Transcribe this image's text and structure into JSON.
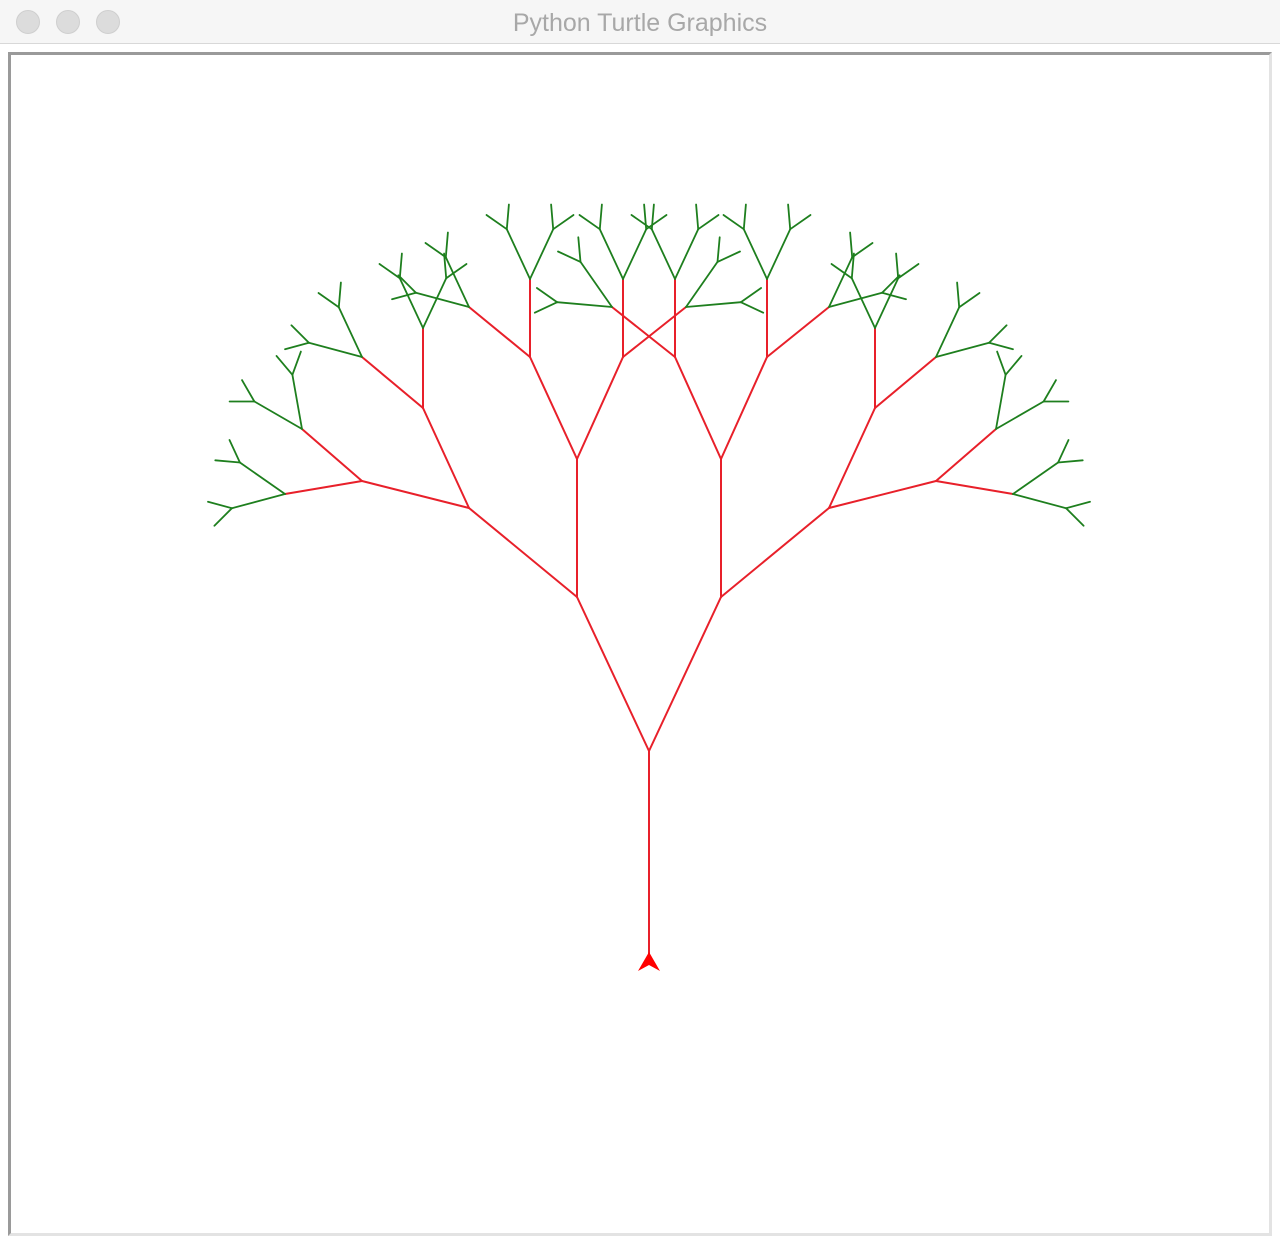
{
  "window": {
    "title": "Python Turtle Graphics"
  },
  "title_buttons": [
    {
      "name": "close-button",
      "color": "#dcdcdc"
    },
    {
      "name": "minimize-button",
      "color": "#dcdcdc"
    },
    {
      "name": "zoom-button",
      "color": "#dcdcdc"
    }
  ],
  "drawing": {
    "trunk_color": "#e8202a",
    "leaf_color": "#1e7f1e",
    "turtle_color": "#ff0000",
    "turtle_shape": "arrow-turtle-icon",
    "turtle_heading": "up"
  }
}
